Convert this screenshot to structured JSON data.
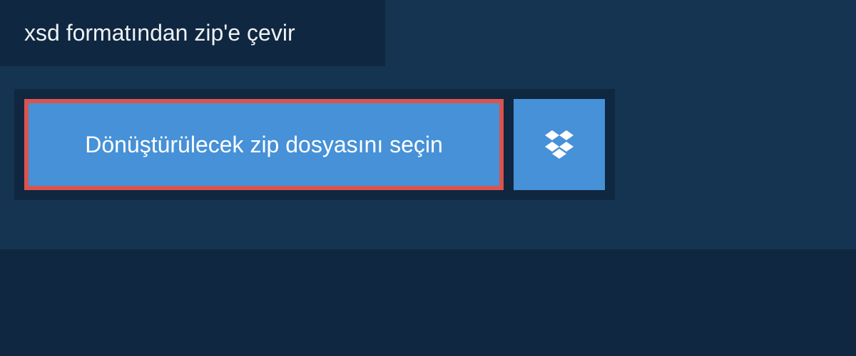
{
  "header": {
    "title": "xsd formatından zip'e çevir"
  },
  "panel": {
    "file_select_label": "Dönüştürülecek zip dosyasını seçin"
  },
  "colors": {
    "background": "#153451",
    "panel": "#0f2740",
    "button": "#4691d8",
    "highlight_border": "#d9544f",
    "text_light": "#ffffff"
  }
}
